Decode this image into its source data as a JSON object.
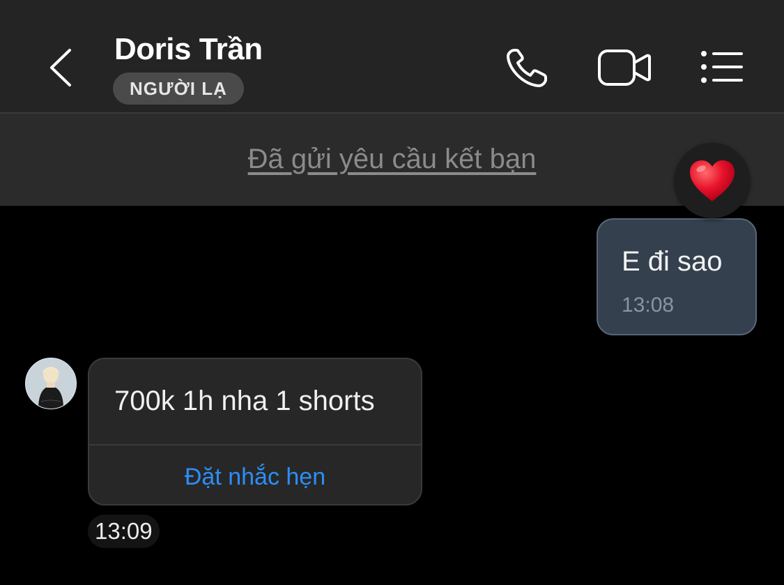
{
  "header": {
    "title": "Doris Trần",
    "badge": "NGƯỜI LẠ",
    "icons": [
      "back-icon",
      "phone-icon",
      "video-call-icon",
      "menu-list-icon"
    ]
  },
  "banner": {
    "friend_request_text": "Đã gửi yêu cầu kết bạn"
  },
  "messages": [
    {
      "direction": "outgoing",
      "text": "E đi sao",
      "time": "13:08",
      "reaction": "heart"
    },
    {
      "direction": "incoming",
      "text": "700k 1h nha 1 shorts",
      "action_label": "Đặt nhắc hẹn",
      "time": "13:09"
    }
  ],
  "colors": {
    "header_bg": "#242424",
    "banner_bg": "#2b2b2b",
    "outgoing_bubble": "#34404e",
    "incoming_bubble": "#272727",
    "link_blue": "#2d8ef5",
    "heart_red": "#e8132c"
  }
}
